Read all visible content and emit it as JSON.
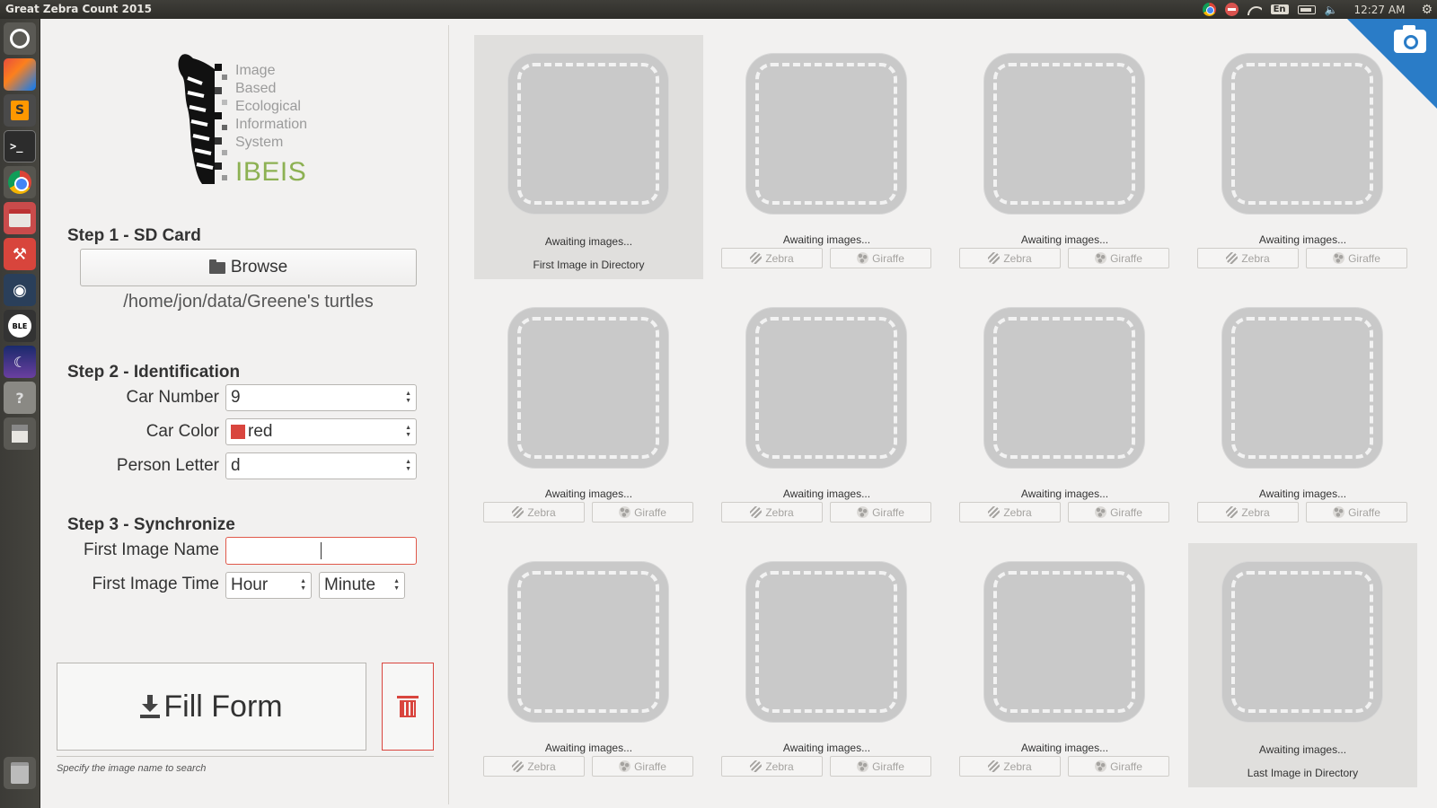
{
  "topbar": {
    "app_title": "Great Zebra Count 2015",
    "keyboard_layout": "En",
    "clock": "12:27 AM",
    "icons": [
      "chrome-icon",
      "stop-icon",
      "wifi-icon",
      "keyboard-icon",
      "battery-icon",
      "volume-icon",
      "settings-gear-icon"
    ]
  },
  "launcher": {
    "items": [
      "ubuntu-dash",
      "intellij-idea",
      "sublime-text",
      "terminal",
      "chrome",
      "file-manager",
      "system-tools",
      "steam",
      "ble-app",
      "night-sky-app",
      "help",
      "save-disk",
      "trash"
    ],
    "sublime_letter": "S",
    "terminal_text": ">_"
  },
  "logo": {
    "words": [
      "Image",
      "Based",
      "Ecological",
      "Information",
      "System"
    ],
    "name": "IBEIS",
    "name_color": "#8db153"
  },
  "step1": {
    "title": "Step 1 - SD Card",
    "browse_label": "Browse",
    "path": "/home/jon/data/Greene's turtles"
  },
  "step2": {
    "title": "Step 2 - Identification",
    "car_number_label": "Car Number",
    "car_number_value": "9",
    "car_color_label": "Car Color",
    "car_color_value": "red",
    "car_color_swatch": "#d9453e",
    "person_letter_label": "Person Letter",
    "person_letter_value": "d"
  },
  "step3": {
    "title": "Step 3 - Synchronize",
    "first_image_name_label": "First Image Name",
    "first_image_name_value": "",
    "first_image_time_label": "First Image Time",
    "hour_value": "Hour",
    "minute_value": "Minute"
  },
  "actions": {
    "fill_form_label": "Fill Form",
    "hint": "Specify the image name to search"
  },
  "grid": {
    "awaiting_text": "Awaiting images...",
    "zebra_label": "Zebra",
    "giraffe_label": "Giraffe",
    "first_label": "First Image in Directory",
    "last_label": "Last Image in Directory"
  },
  "colors": {
    "accent_blue": "#2a7cc7",
    "error_red": "#d9453e"
  }
}
